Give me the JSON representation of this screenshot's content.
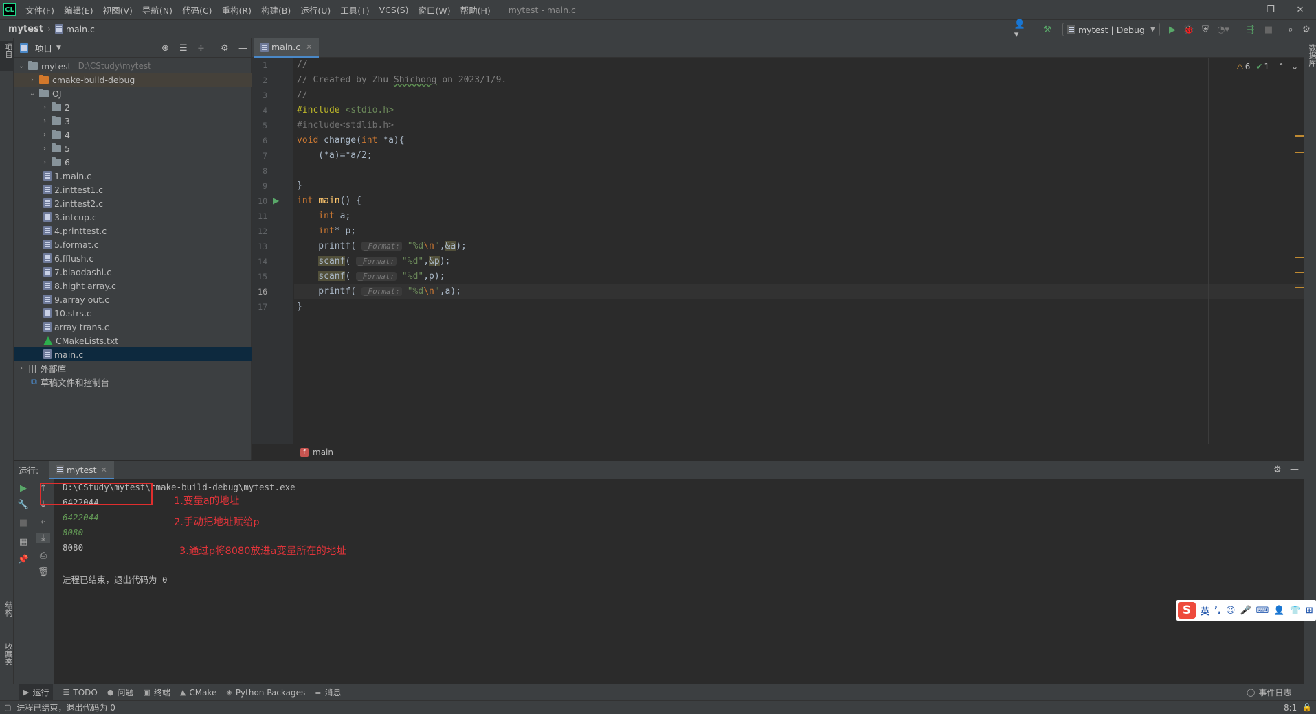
{
  "titlebar": {
    "logo": "CL",
    "menu": [
      "文件(F)",
      "编辑(E)",
      "视图(V)",
      "导航(N)",
      "代码(C)",
      "重构(R)",
      "构建(B)",
      "运行(U)",
      "工具(T)",
      "VCS(S)",
      "窗口(W)",
      "帮助(H)"
    ],
    "window_title": "mytest - main.c"
  },
  "navbar": {
    "project": "mytest",
    "file": "main.c",
    "run_config": "mytest | Debug"
  },
  "left_stripe": {
    "project_label": "项目",
    "structure_label": "结构",
    "favorites_label": "收藏夹"
  },
  "right_stripe": {
    "database_label": "数据库"
  },
  "project_panel": {
    "title": "项目",
    "tree": [
      {
        "label": "mytest",
        "hint": "D:\\CStudy\\mytest"
      },
      {
        "label": "cmake-build-debug"
      },
      {
        "label": "OJ"
      },
      {
        "label": "2"
      },
      {
        "label": "3"
      },
      {
        "label": "4"
      },
      {
        "label": "5"
      },
      {
        "label": "6"
      },
      {
        "label": "1.main.c"
      },
      {
        "label": "2.inttest1.c"
      },
      {
        "label": "2.inttest2.c"
      },
      {
        "label": "3.intcup.c"
      },
      {
        "label": "4.printtest.c"
      },
      {
        "label": "5.format.c"
      },
      {
        "label": "6.fflush.c"
      },
      {
        "label": "7.biaodashi.c"
      },
      {
        "label": "8.hight array.c"
      },
      {
        "label": "9.array out.c"
      },
      {
        "label": "10.strs.c"
      },
      {
        "label": "array trans.c"
      },
      {
        "label": "CMakeLists.txt"
      },
      {
        "label": "main.c"
      },
      {
        "label": "外部库"
      },
      {
        "label": "草稿文件和控制台"
      }
    ]
  },
  "editor": {
    "tab": "main.c",
    "warnings": "6",
    "checks": "1",
    "breadcrumb": "main",
    "line_numbers": [
      "1",
      "2",
      "3",
      "4",
      "5",
      "6",
      "7",
      "8",
      "9",
      "10",
      "11",
      "12",
      "13",
      "14",
      "15",
      "16",
      "17"
    ],
    "hint_format": "_Format:",
    "code": {
      "l1": "//",
      "l2a": "// Created by Zhu ",
      "l2b": "Shichong",
      "l2c": " on 2023/1/9.",
      "l3": "//",
      "l4a": "#include ",
      "l4b": "<stdio.h>",
      "l5a": "#include",
      "l5b": "<stdlib.h>",
      "l6a": "void ",
      "l6b": "change(",
      "l6c": "int ",
      "l6d": "*a){",
      "l7": "    (*a)=*a/2;",
      "l9": "}",
      "l10a": "int ",
      "l10b": "main",
      "l10c": "() {",
      "l11a": "    int ",
      "l11b": "a;",
      "l12a": "    int",
      "l12b": "* p;",
      "l13a": "    printf(",
      "l13b": "\"%d",
      "l13c": "\\n",
      "l13d": "\"",
      "l13e": ",",
      "l13f": "&a",
      "l13g": ");",
      "l14a": "scanf",
      "l14b": "(",
      "l14c": "\"%d\"",
      "l14d": ",",
      "l14e": "&p",
      "l14f": ");",
      "l15a": "scanf",
      "l15b": "(",
      "l15c": "\"%d\"",
      "l15d": ",p);",
      "l16a": "    printf(",
      "l16b": "\"%d",
      "l16c": "\\n",
      "l16d": "\"",
      "l16e": ",a);",
      "l17": "}"
    }
  },
  "run_panel": {
    "label": "运行:",
    "tab": "mytest",
    "console": {
      "path": "D:\\CStudy\\mytest\\cmake-build-debug\\mytest.exe",
      "out1": "6422044",
      "in1": "6422044",
      "in2": "8080",
      "out2": "8080",
      "exit": "进程已结束，退出代码为 0"
    },
    "annotations": {
      "a1": "1.变量a的地址",
      "a2": "2.手动把地址赋给p",
      "a3": "3.通过p将8080放进a变量所在的地址"
    },
    "colors": {
      "annotation": "#e0343a",
      "input": "#629755"
    }
  },
  "ime": {
    "logo": "S",
    "lang": "英",
    "items": [
      "’,",
      "☺",
      "🎤",
      "⌨",
      "👤",
      "👕",
      "⊞"
    ]
  },
  "toolwindows": [
    "运行",
    "TODO",
    "问题",
    "终端",
    "CMake",
    "Python Packages",
    "消息"
  ],
  "event_log": "事件日志",
  "status": {
    "message": "进程已结束，退出代码为 0",
    "position": "8:1"
  }
}
